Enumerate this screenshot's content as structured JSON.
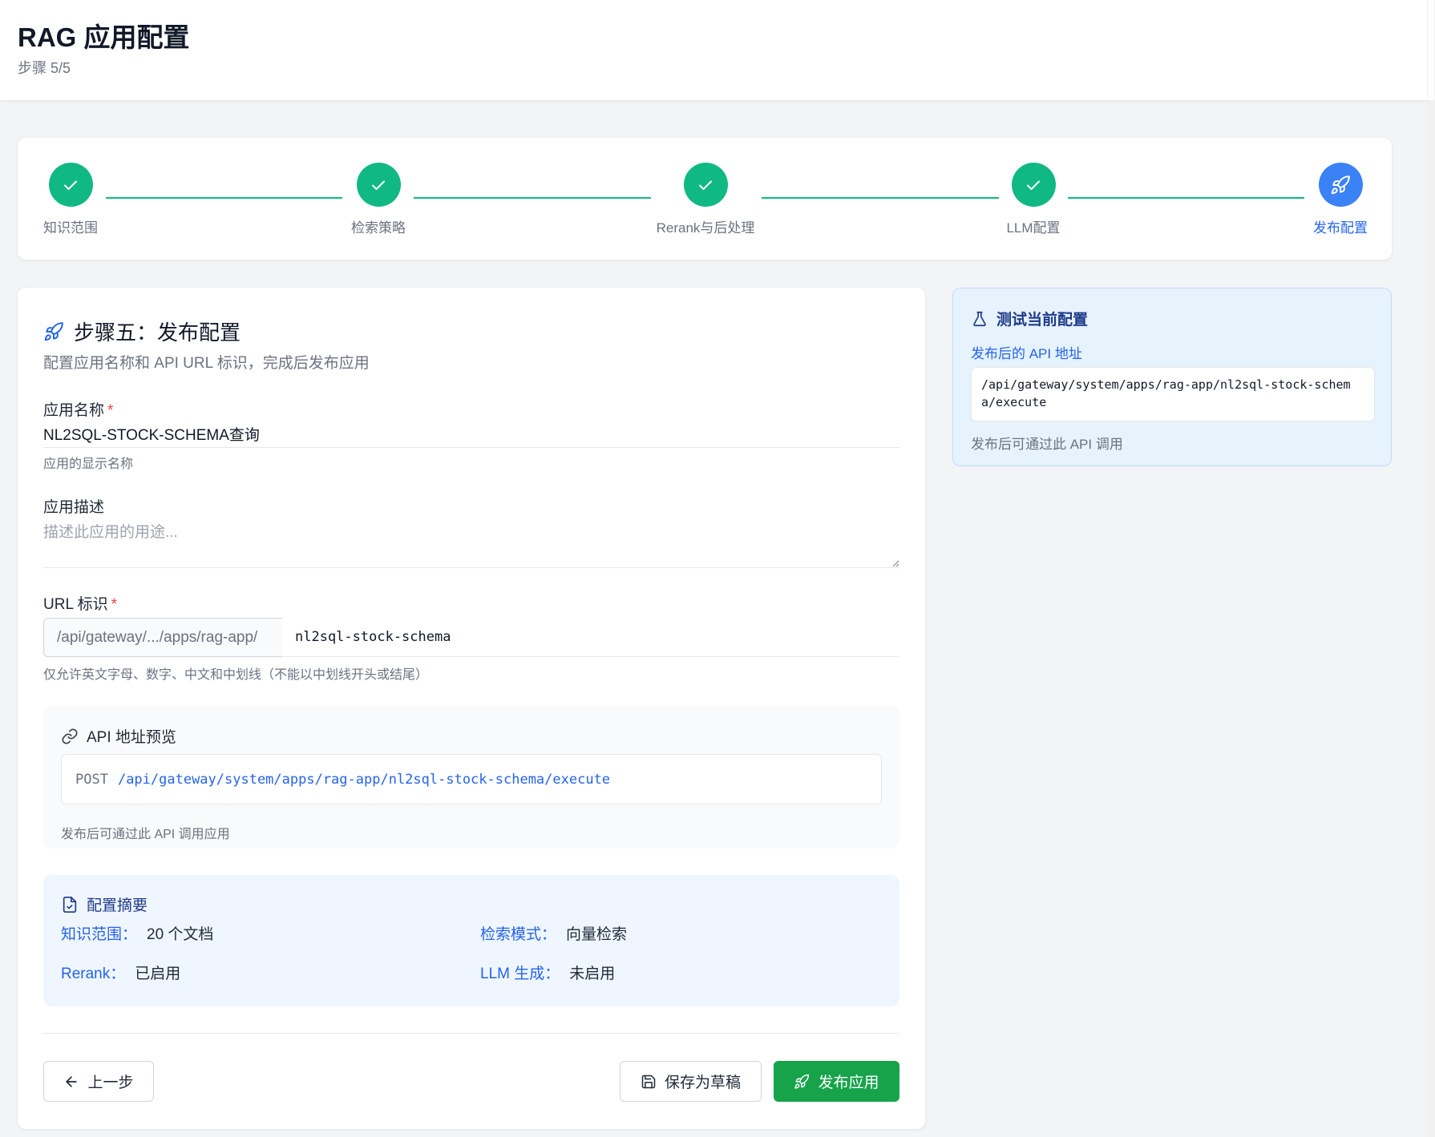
{
  "header": {
    "title": "RAG 应用配置",
    "subtitle": "步骤 5/5"
  },
  "stepper": {
    "steps": [
      {
        "label": "知识范围",
        "status": "done"
      },
      {
        "label": "检索策略",
        "status": "done"
      },
      {
        "label": "Rerank与后处理",
        "status": "done"
      },
      {
        "label": "LLM配置",
        "status": "done"
      },
      {
        "label": "发布配置",
        "status": "active"
      }
    ]
  },
  "form": {
    "section_title": "步骤五：发布配置",
    "section_desc": "配置应用名称和 API URL 标识，完成后发布应用",
    "name_label": "应用名称",
    "required_mark": "*",
    "name_value": "NL2SQL-STOCK-SCHEMA查询",
    "name_hint": "应用的显示名称",
    "desc_label": "应用描述",
    "desc_placeholder": "描述此应用的用途...",
    "url_label": "URL 标识",
    "url_prefix": "/api/gateway/.../apps/rag-app/",
    "url_value": "nl2sql-stock-schema",
    "url_hint": "仅允许英文字母、数字、中文和中划线（不能以中划线开头或结尾）"
  },
  "preview": {
    "title": "API 地址预览",
    "method": "POST",
    "path": "/api/gateway/system/apps/rag-app/nl2sql-stock-schema/execute",
    "hint": "发布后可通过此 API 调用应用"
  },
  "summary": {
    "title": "配置摘要",
    "items": [
      {
        "key": "知识范围：",
        "value": "20 个文档"
      },
      {
        "key": "检索模式：",
        "value": "向量检索"
      },
      {
        "key": "Rerank：",
        "value": "已启用"
      },
      {
        "key": "LLM 生成：",
        "value": "未启用"
      }
    ]
  },
  "buttons": {
    "prev": "上一步",
    "draft": "保存为草稿",
    "publish": "发布应用"
  },
  "side": {
    "title": "测试当前配置",
    "label": "发布后的 API 地址",
    "code": "/api/gateway/system/apps/rag-app/nl2sql-stock-schema/execute",
    "hint": "发布后可通过此 API 调用"
  },
  "colors": {
    "success": "#10b981",
    "primary": "#3b82f6",
    "publish": "#16a34a",
    "link": "#2563eb"
  }
}
